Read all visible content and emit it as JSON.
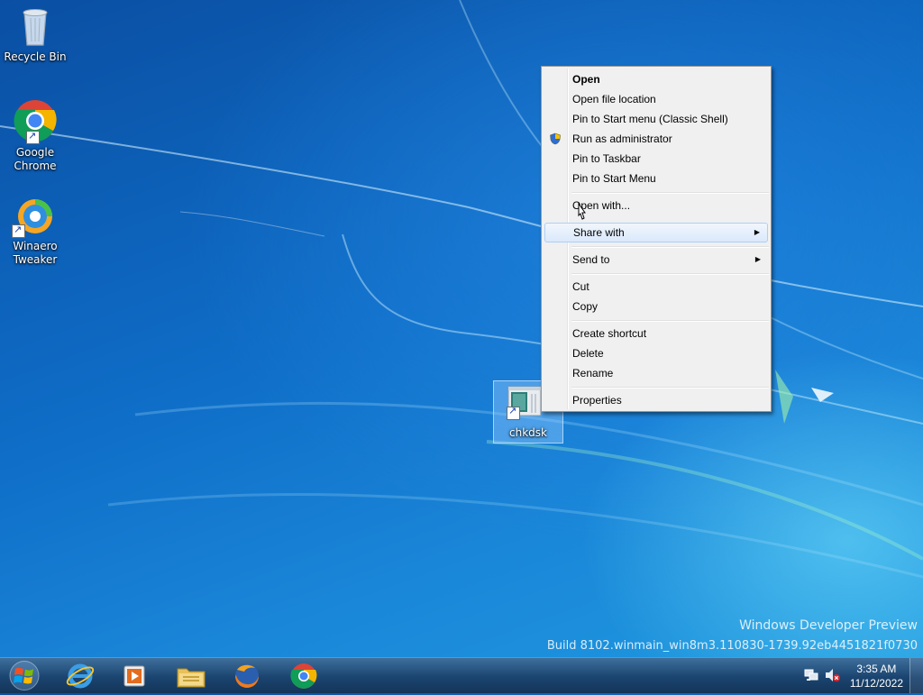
{
  "desktop": {
    "icons": [
      {
        "label": "Recycle Bin",
        "icon": "recycle-bin-icon"
      },
      {
        "label": "Google Chrome",
        "line1": "Google",
        "line2": "Chrome",
        "icon": "chrome-icon"
      },
      {
        "label": "Winaero Tweaker",
        "line1": "Winaero",
        "line2": "Tweaker",
        "icon": "winaero-tweaker-icon"
      },
      {
        "label": "chkdsk",
        "icon": "chkdsk-shortcut-icon",
        "selected": true
      }
    ],
    "watermark": {
      "line1": "Windows Developer Preview",
      "line2": "Build 8102.winmain_win8m3.110830-1739.92eb4451821f0730"
    }
  },
  "context_menu": {
    "items": [
      {
        "label": "Open",
        "bold": true
      },
      {
        "label": "Open file location"
      },
      {
        "label": "Pin to Start menu (Classic Shell)"
      },
      {
        "label": "Run as administrator",
        "icon": "uac-shield-icon"
      },
      {
        "label": "Pin to Taskbar"
      },
      {
        "label": "Pin to Start Menu"
      },
      {
        "label": "Open with..."
      },
      {
        "label": "Share with",
        "submenu": true,
        "highlighted": true
      },
      {
        "label": "Send to",
        "submenu": true
      },
      {
        "label": "Cut"
      },
      {
        "label": "Copy"
      },
      {
        "label": "Create shortcut"
      },
      {
        "label": "Delete"
      },
      {
        "label": "Rename"
      },
      {
        "label": "Properties"
      }
    ],
    "submenu_arrow": "▶"
  },
  "taskbar": {
    "start": "windows-start-icon",
    "pinned": [
      "internet-explorer-icon",
      "media-player-icon",
      "file-explorer-icon",
      "firefox-icon",
      "chrome-icon"
    ],
    "tray": {
      "icons": [
        "network-icon",
        "volume-muted-icon"
      ],
      "time": "3:35 AM",
      "date": "11/12/2022"
    }
  },
  "colors": {
    "desktop_blue": "#0f6ec8",
    "menu_bg": "#f0f0f0",
    "taskbar": "#1b4470"
  }
}
